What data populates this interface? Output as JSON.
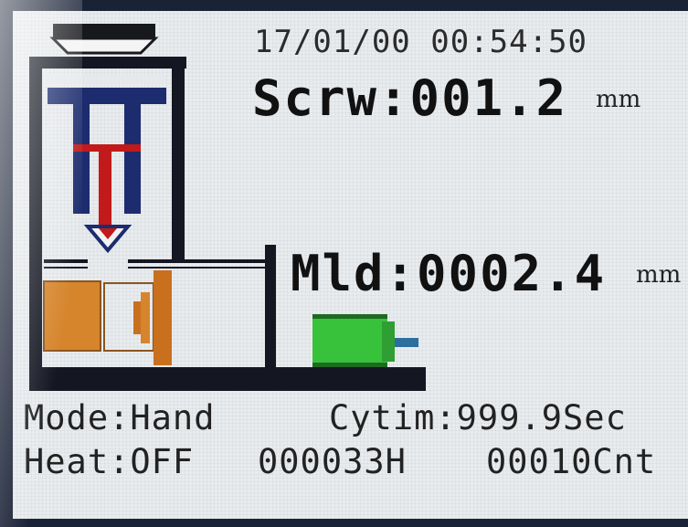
{
  "datetime": "17/01/00 00:54:50",
  "screw": {
    "label": "Scrw:001.2",
    "unit": "mm"
  },
  "mold": {
    "label": "Mld:0002.4",
    "unit": "mm"
  },
  "status": {
    "mode": "Mode:Hand",
    "cycle_time": "Cytim:999.9Sec",
    "heat": "Heat:OFF",
    "hours": "000033H",
    "count": "00010Cnt"
  },
  "colors": {
    "frame": "#1a2236",
    "hopper": "#18191c",
    "ram": "#1c2c6e",
    "screw": "#c21a1a",
    "mold_orange": "#d6852c",
    "motor": "#38c23c",
    "shaft": "#2d6e9e"
  },
  "icons": {
    "hopper": "hopper-icon",
    "injection_unit": "injection-unit-icon",
    "mold": "mold-icon",
    "motor": "motor-icon"
  }
}
